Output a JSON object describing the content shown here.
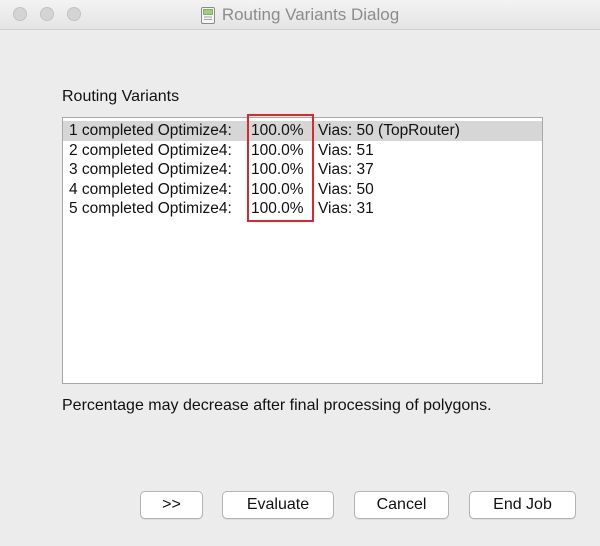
{
  "window": {
    "title": "Routing Variants Dialog",
    "title_icon": "document-icon"
  },
  "group": {
    "label": "Routing Variants"
  },
  "variants": [
    {
      "status": "1 completed Optimize4:",
      "percent": "100.0%",
      "vias": "Vias: 50 (TopRouter)",
      "selected": true
    },
    {
      "status": "2 completed Optimize4:",
      "percent": "100.0%",
      "vias": "Vias: 51",
      "selected": false
    },
    {
      "status": "3 completed Optimize4:",
      "percent": "100.0%",
      "vias": "Vias: 37",
      "selected": false
    },
    {
      "status": "4 completed Optimize4:",
      "percent": "100.0%",
      "vias": "Vias: 50",
      "selected": false
    },
    {
      "status": "5 completed Optimize4:",
      "percent": "100.0%",
      "vias": "Vias: 31",
      "selected": false
    }
  ],
  "note": "Percentage may decrease after final processing of polygons.",
  "buttons": {
    "more": ">>",
    "evaluate": "Evaluate",
    "cancel": "Cancel",
    "end_job": "End Job"
  },
  "colors": {
    "highlight": "#e0262a",
    "selection": "#d6d6d6"
  }
}
